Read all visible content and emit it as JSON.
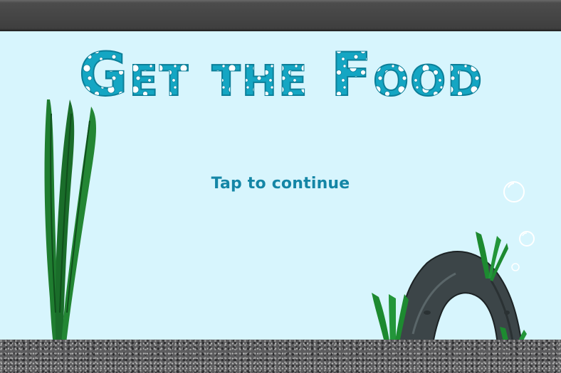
{
  "game": {
    "title": "Get the Food",
    "prompt": "Tap to continue"
  },
  "colors": {
    "water": "#d7f5fd",
    "title_fill": "#14a6c3",
    "title_outline": "#0c7f99",
    "prompt_text": "#1486a6",
    "seaweed": "#1d7a2e",
    "rock": "#3c4548",
    "gravel": "#5c5c5e"
  }
}
